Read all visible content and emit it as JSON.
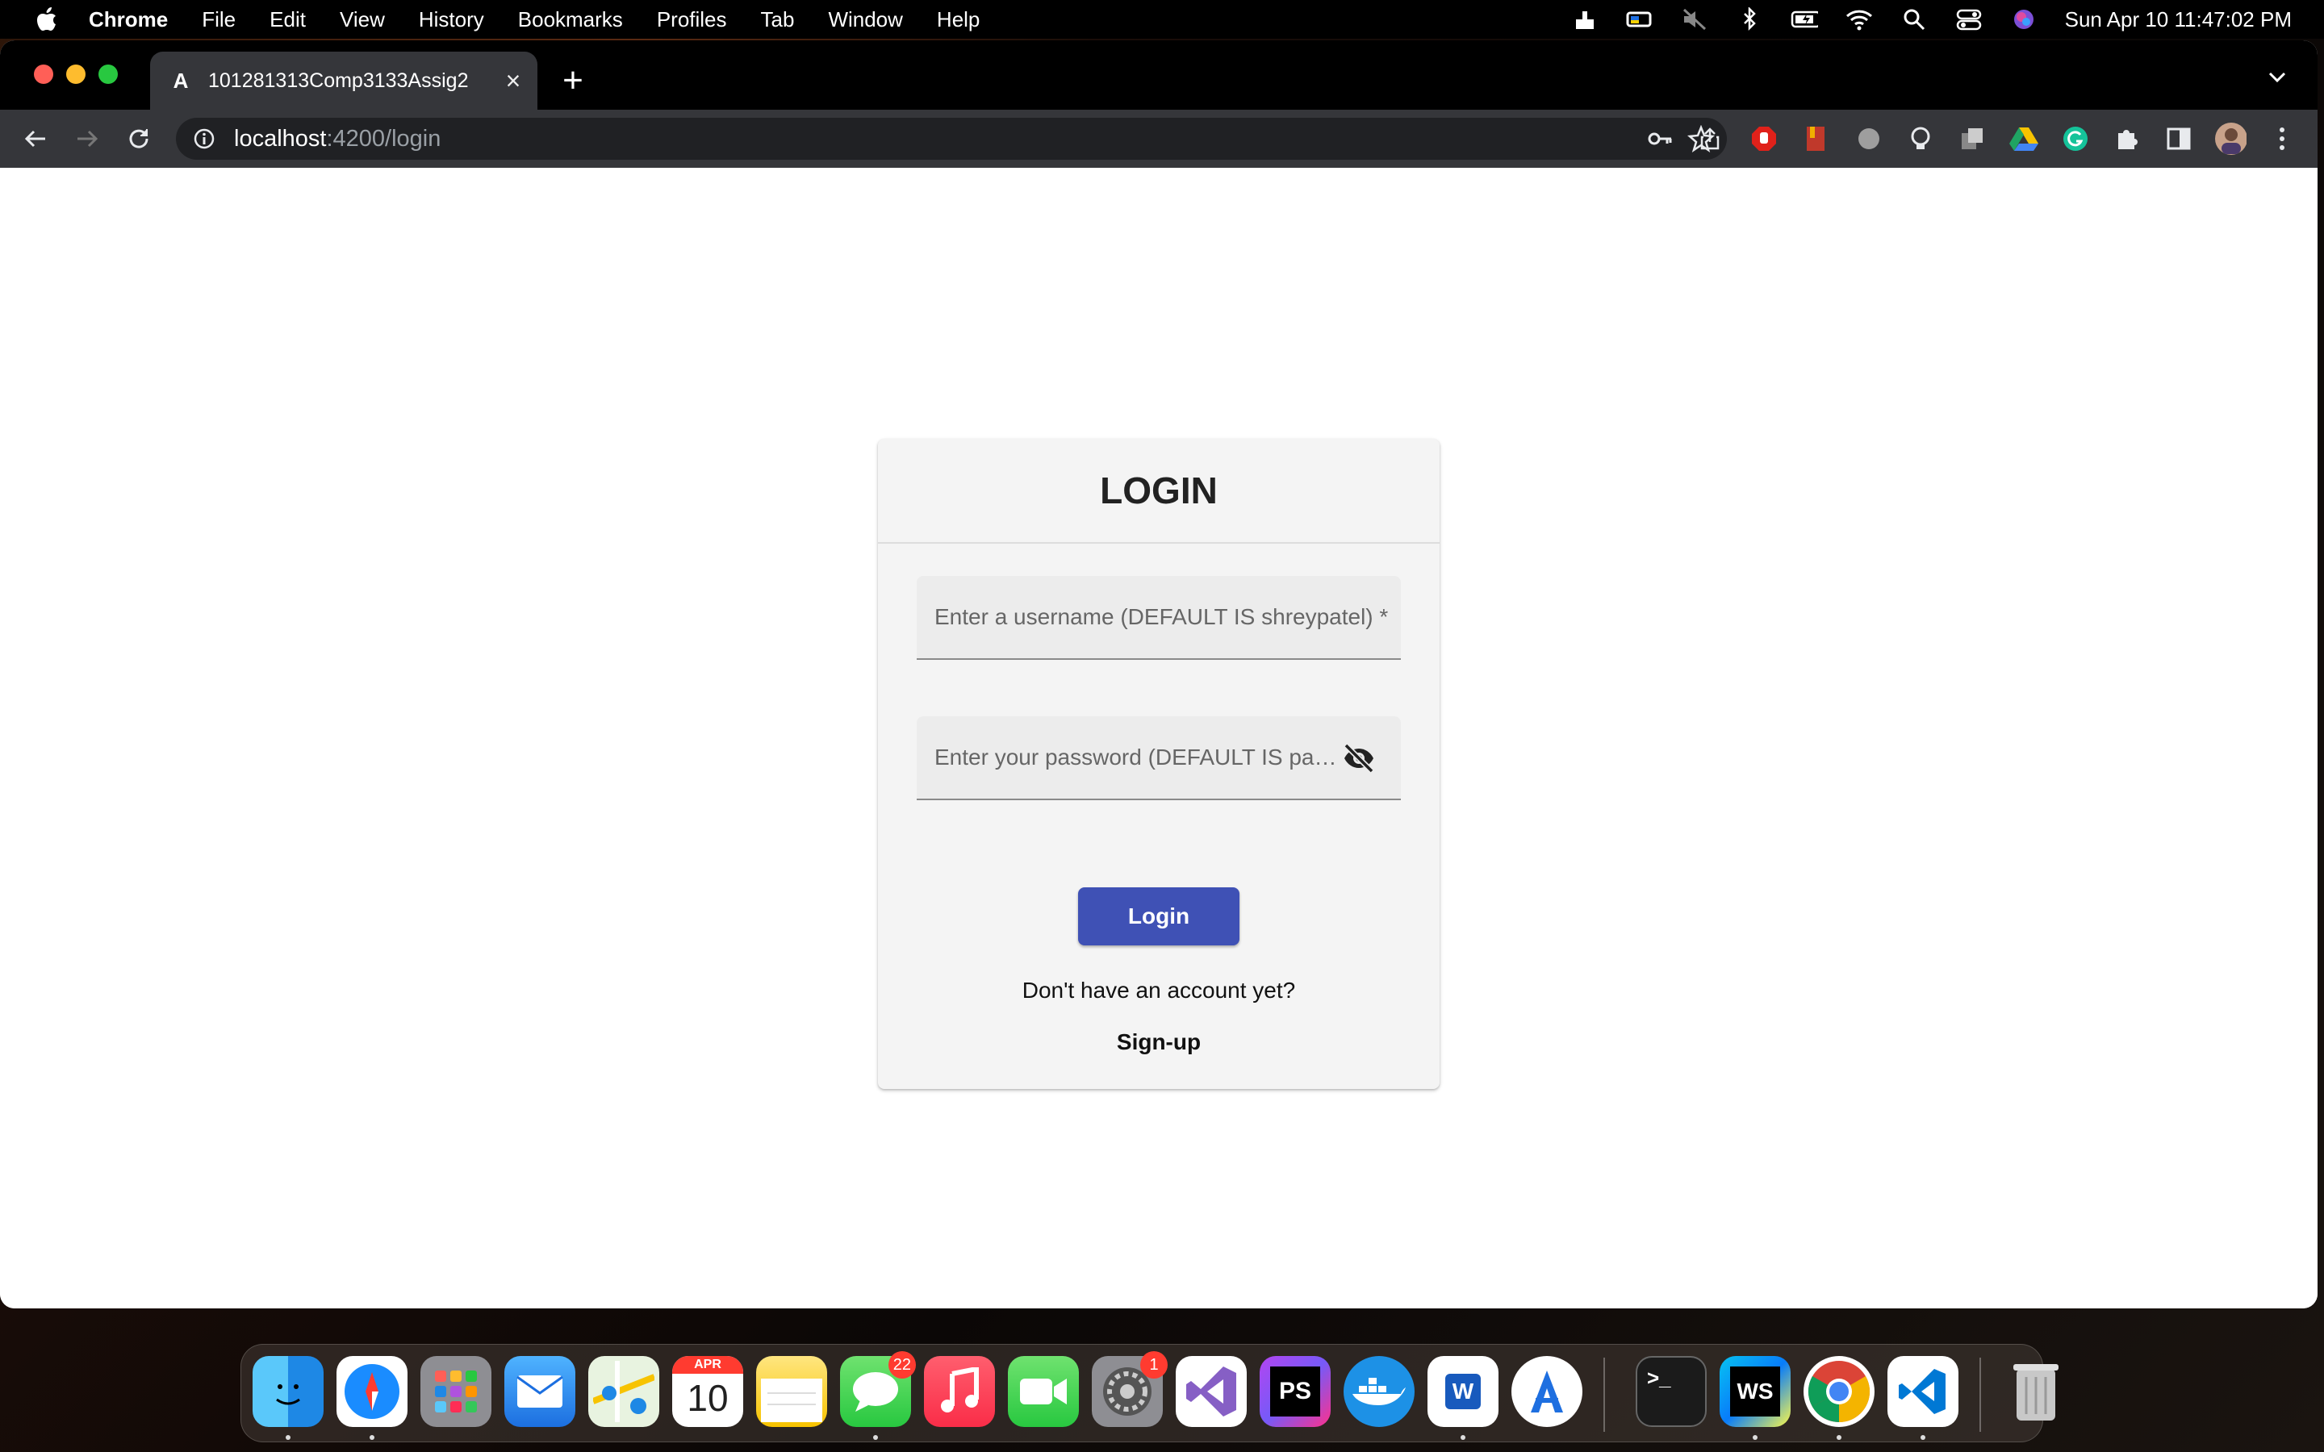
{
  "menubar": {
    "app_name": "Chrome",
    "items": [
      "File",
      "Edit",
      "View",
      "History",
      "Bookmarks",
      "Profiles",
      "Tab",
      "Window",
      "Help"
    ],
    "clock": "Sun Apr 10  11:47:02 PM",
    "status_icons": [
      "display-icon",
      "flag-icon",
      "mute-icon",
      "bluetooth-icon",
      "battery-icon",
      "wifi-icon",
      "spotlight-icon",
      "control-center-icon",
      "siri-icon"
    ]
  },
  "browser": {
    "tab_title": "101281313Comp3133Assig2",
    "tab_favicon": "A",
    "url_host": "localhost",
    "url_path": ":4200/login",
    "extensions": [
      "adblock-icon",
      "bookmark-ext-icon",
      "circle-ext-icon",
      "bulb-ext-icon",
      "window-ext-icon",
      "drive-icon",
      "grammarly-icon",
      "puzzle-icon",
      "sidepanel-icon",
      "profile-avatar",
      "kebab-menu-icon"
    ]
  },
  "login": {
    "title": "LOGIN",
    "username_placeholder": "Enter a username (DEFAULT IS shreypatel) *",
    "password_placeholder": "Enter your password (DEFAULT IS pas...",
    "login_button": "Login",
    "no_account_text": "Don't have an account yet?",
    "signup_link": "Sign-up",
    "primary_color": "#3f51b5"
  },
  "dock": {
    "calendar_month": "APR",
    "calendar_day": "10",
    "messages_badge": "22",
    "settings_badge": "1",
    "phpstorm_label": "PS",
    "webstorm_label": "WS",
    "word_label": "W",
    "terminal_label": ">_"
  }
}
